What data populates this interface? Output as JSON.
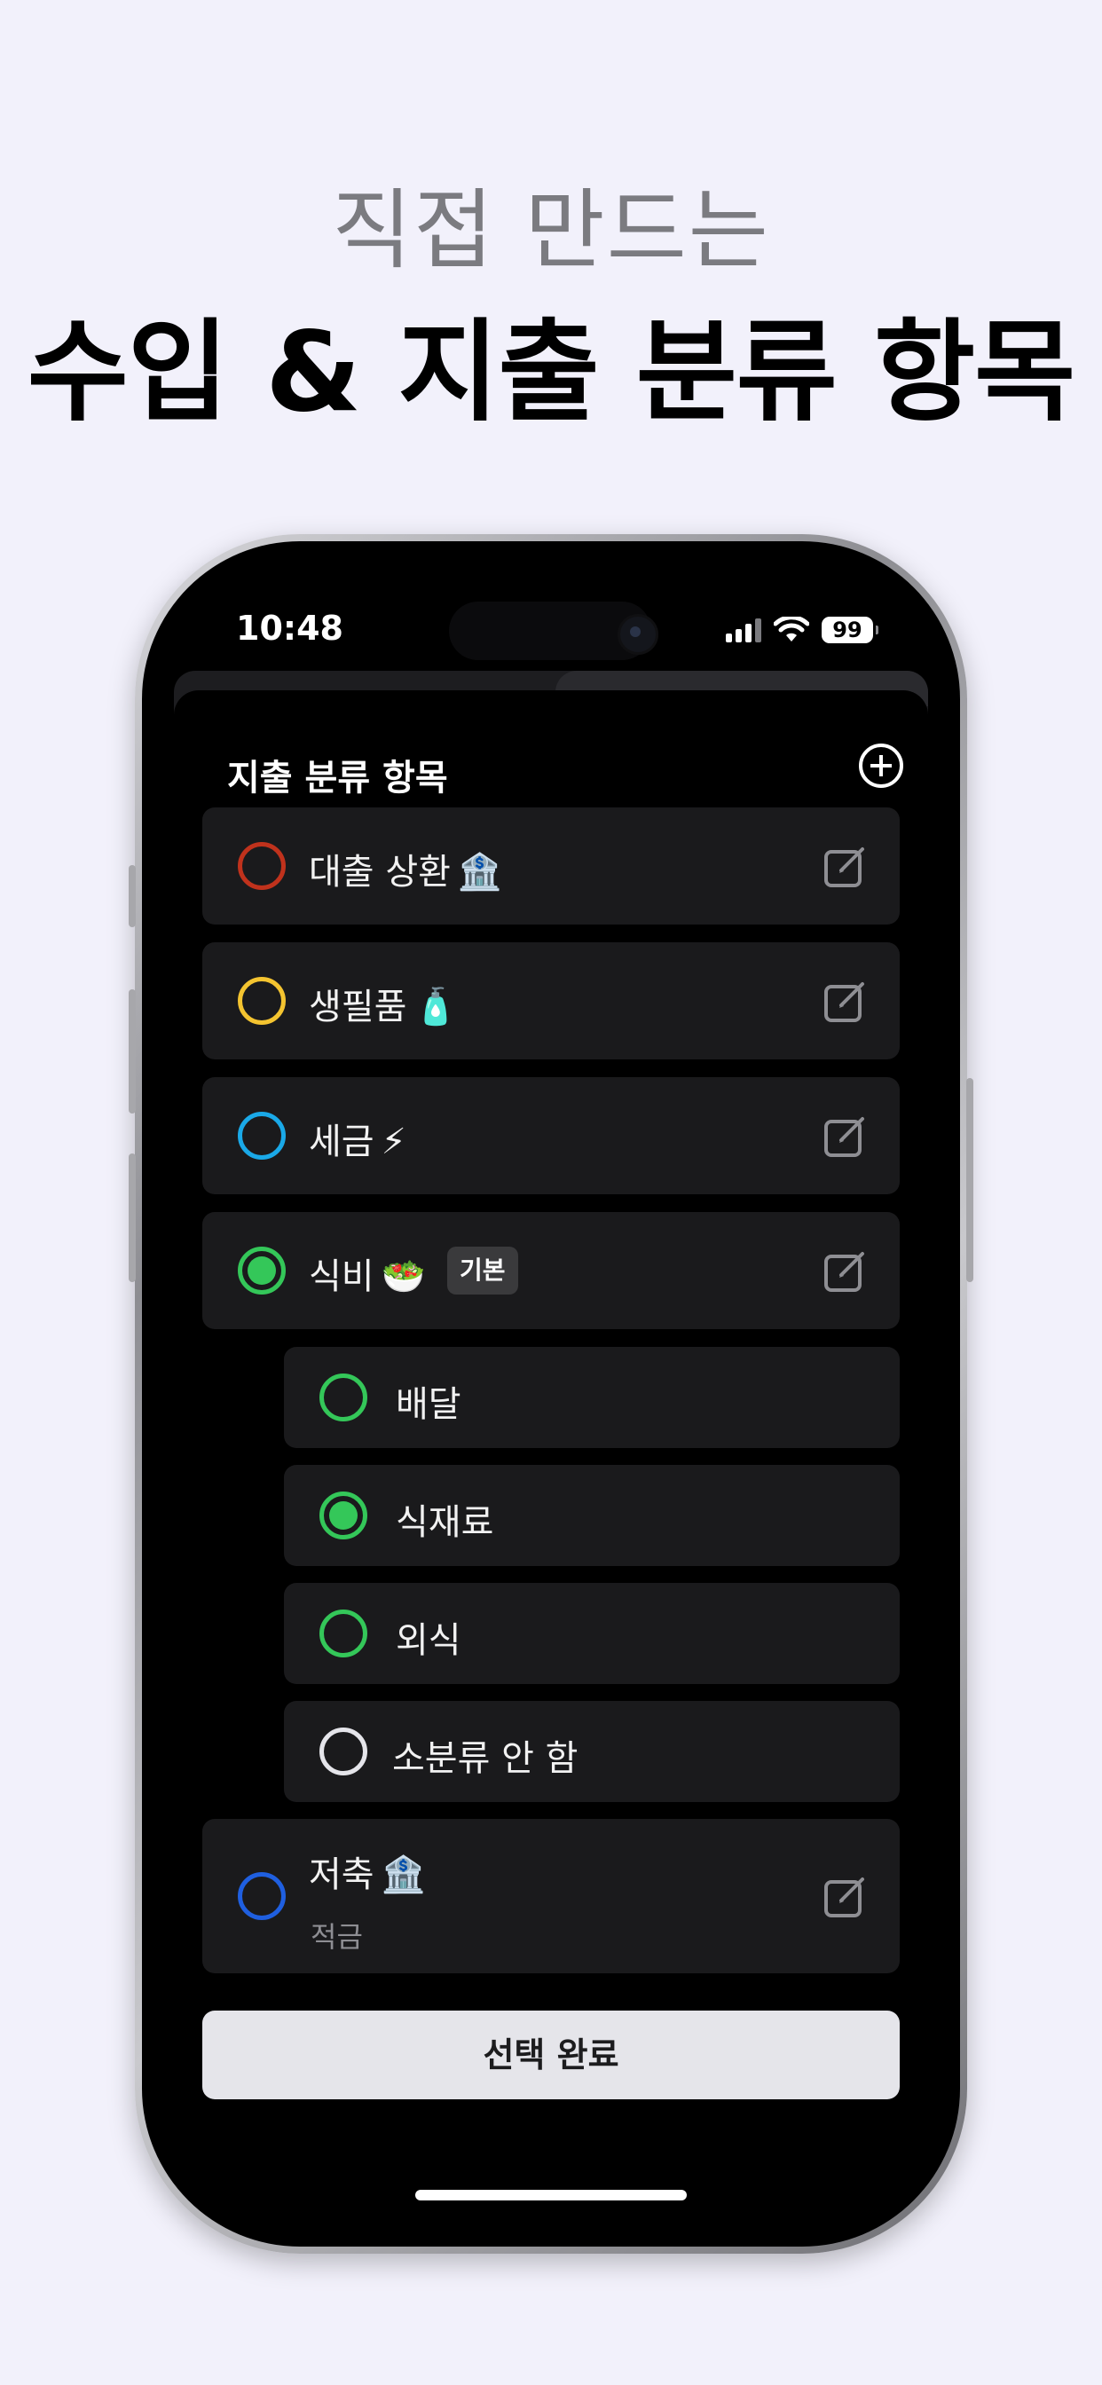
{
  "headline": {
    "line1": "직접 만드는",
    "line2": "수입 & 지출 분류 항목"
  },
  "status_bar": {
    "time": "10:48",
    "battery": "99",
    "icons": [
      "signal-icon",
      "wifi-icon",
      "battery-icon"
    ]
  },
  "sheet": {
    "title": "지출 분류 항목",
    "add_icon": "plus-circle-icon"
  },
  "categories": [
    {
      "name": "대출 상환",
      "emoji": "🏦",
      "color": "#c0321c",
      "selected": false
    },
    {
      "name": "생필품",
      "emoji": "🧴",
      "color": "#f4c430",
      "selected": false
    },
    {
      "name": "세금",
      "emoji": "⚡",
      "color": "#1aa9e8",
      "selected": false
    },
    {
      "name": "식비",
      "emoji": "🥗",
      "color": "#34c759",
      "selected": true,
      "badge": "기본"
    }
  ],
  "subcategories": [
    {
      "name": "배달",
      "color": "#34c759",
      "selected": false
    },
    {
      "name": "식재료",
      "color": "#34c759",
      "selected": true
    },
    {
      "name": "외식",
      "color": "#34c759",
      "selected": false
    },
    {
      "name": "소분류 안 함",
      "color": "#e5e5ea",
      "selected": false
    }
  ],
  "savings": {
    "name": "저축",
    "emoji": "🏦",
    "sublabel": "적금",
    "color": "#1f5fe0",
    "selected": false
  },
  "done_button": "선택 완료",
  "edit_icon": "edit-icon"
}
